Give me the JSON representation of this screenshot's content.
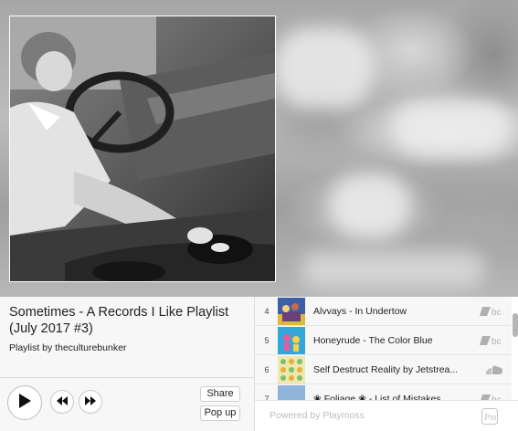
{
  "playlist": {
    "title": "Sometimes - A Records I Like Playlist (July 2017 #3)",
    "byline": "Playlist by theculturebunker"
  },
  "controls": {
    "share_label": "Share",
    "popup_label": "Pop up"
  },
  "tracks": [
    {
      "number": "4",
      "name": "Alvvays - In Undertow",
      "source_icon": "bandcamp-icon",
      "thumb_color": "#3c5fa6"
    },
    {
      "number": "5",
      "name": "Honeyrude - The Color Blue",
      "source_icon": "bandcamp-icon",
      "thumb_color": "#35a6d9"
    },
    {
      "number": "6",
      "name": "Self Destruct Reality by Jetstrea...",
      "source_icon": "soundcloud-icon",
      "thumb_color": "#d8c34a"
    },
    {
      "number": "7",
      "name": "❀ Foliage ❀ - List of Mistakes",
      "source_icon": "bandcamp-icon",
      "thumb_color": "#8fb3d9"
    }
  ],
  "footer": {
    "powered_label": "Powered by",
    "brand": "Playmoss"
  },
  "colors": {
    "panel_bg": "#f7f7f7",
    "text": "#222222",
    "muted": "#bdbdbd",
    "source_icon": "#b0b0b0"
  }
}
